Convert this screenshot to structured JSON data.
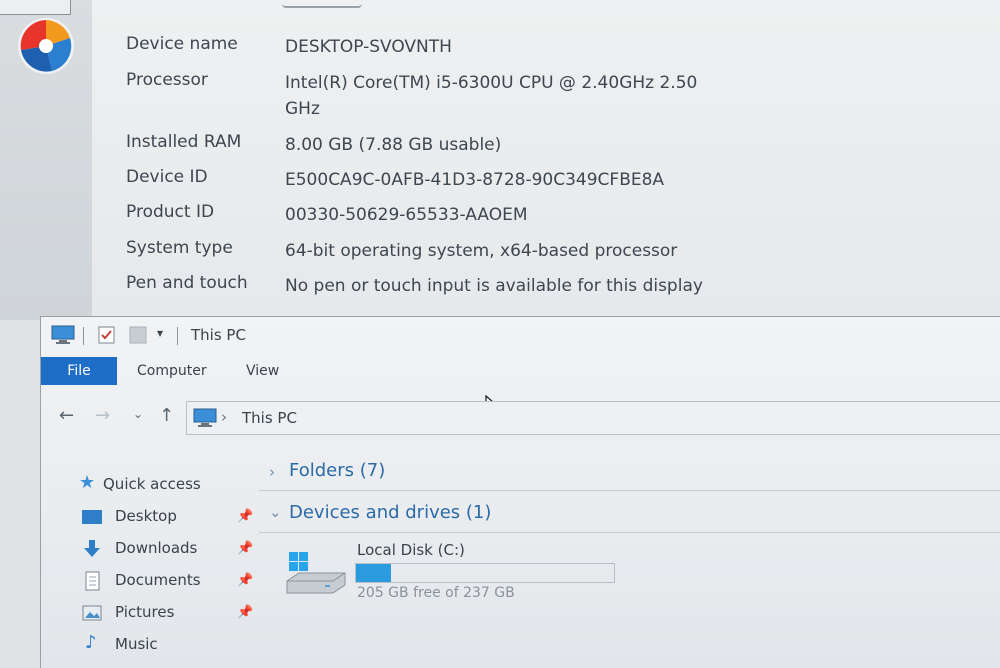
{
  "system_info": {
    "specs": [
      {
        "label": "Device name",
        "value": "DESKTOP-SVOVNTH"
      },
      {
        "label": "Processor",
        "value": "Intel(R) Core(TM) i5-6300U CPU @ 2.40GHz   2.50 GHz"
      },
      {
        "label": "Installed RAM",
        "value": "8.00 GB (7.88 GB usable)"
      },
      {
        "label": "Device ID",
        "value": "E500CA9C-0AFB-41D3-8728-90C349CFBE8A"
      },
      {
        "label": "Product ID",
        "value": "00330-50629-65533-AAOEM"
      },
      {
        "label": "System type",
        "value": "64-bit operating system, x64-based processor"
      },
      {
        "label": "Pen and touch",
        "value": "No pen or touch input is available for this display"
      }
    ]
  },
  "explorer": {
    "title": "This PC",
    "ribbon_tabs": {
      "file": "File",
      "computer": "Computer",
      "view": "View"
    },
    "address": {
      "location": "This PC"
    },
    "sidebar": {
      "quick_access": "Quick access",
      "items": [
        {
          "label": "Desktop",
          "icon": "desktop-icon",
          "pinned": true
        },
        {
          "label": "Downloads",
          "icon": "downloads-icon",
          "pinned": true
        },
        {
          "label": "Documents",
          "icon": "documents-icon",
          "pinned": true
        },
        {
          "label": "Pictures",
          "icon": "pictures-icon",
          "pinned": true
        },
        {
          "label": "Music",
          "icon": "music-icon",
          "pinned": false
        }
      ]
    },
    "groups": {
      "folders": "Folders (7)",
      "devices": "Devices and drives (1)"
    },
    "drive": {
      "label": "Local Disk (C:)",
      "free_text": "205 GB free of 237 GB",
      "used_fraction": 0.135
    }
  },
  "colors": {
    "file_tab": "#1e6ec8",
    "group_header": "#2b6aa6",
    "drive_bar": "#2b9be0"
  }
}
